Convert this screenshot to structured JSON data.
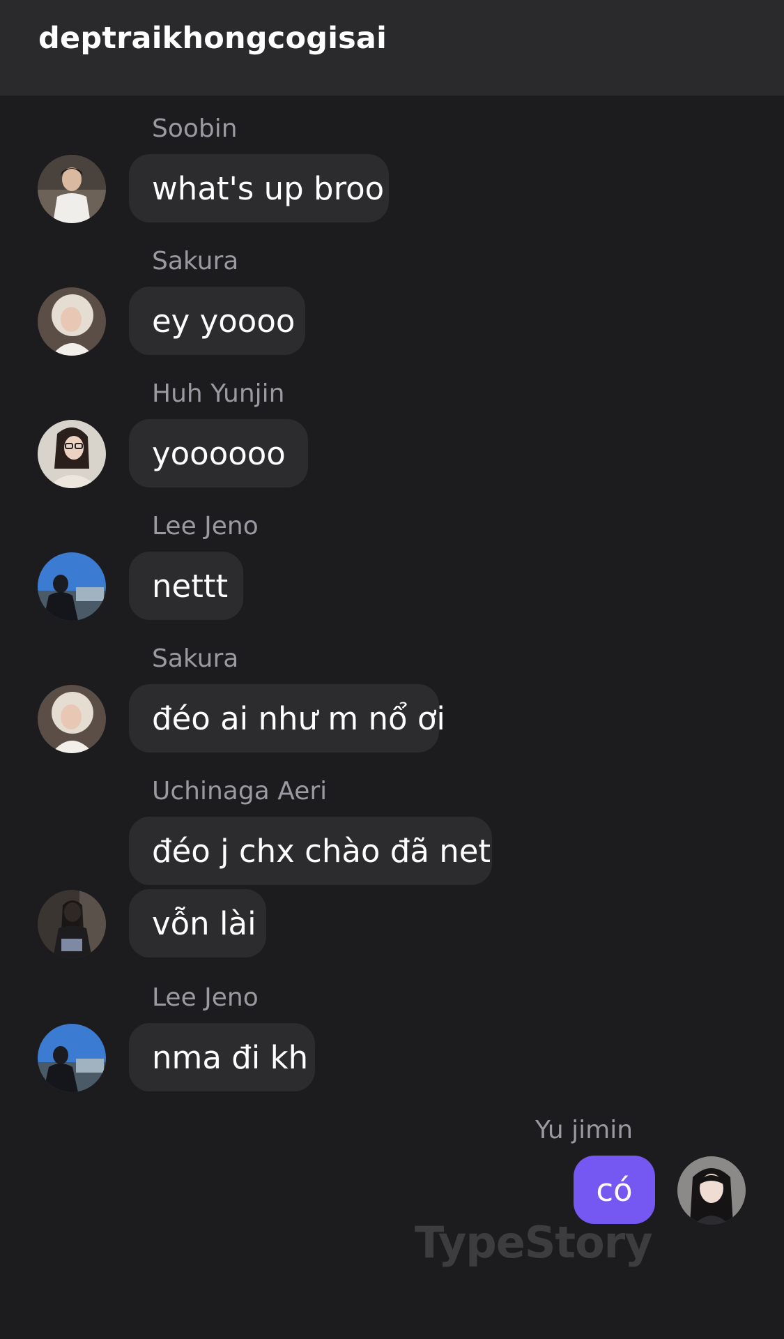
{
  "header": {
    "title": "deptraikhongcogisai"
  },
  "messages": [
    {
      "sender": "Soobin",
      "text": "what's up broo"
    },
    {
      "sender": "Sakura",
      "text": "ey yoooo"
    },
    {
      "sender": "Huh Yunjin",
      "text": "yoooooo"
    },
    {
      "sender": "Lee Jeno",
      "text": "nettt"
    },
    {
      "sender": "Sakura",
      "text": "đéo ai như m nổ ơi"
    },
    {
      "sender": "Uchinaga Aeri",
      "text": "đéo j chx chào đã net"
    },
    {
      "sender": "",
      "text": "vỗn lài"
    },
    {
      "sender": "Lee Jeno",
      "text": "nma đi kh"
    },
    {
      "sender": "Yu jimin",
      "text": "có"
    }
  ],
  "watermark": "TypeStory",
  "colors": {
    "background": "#1c1c1e",
    "header": "#2a2a2c",
    "bubble_other": "#2c2c2e",
    "bubble_self": "#7557f2",
    "sender_name": "#9a9aa0"
  },
  "avatars": {
    "soobin": "avatar-photo",
    "sakura": "avatar-photo",
    "huh_yunjin": "avatar-photo",
    "lee_jeno": "avatar-photo",
    "uchinaga_aeri": "avatar-photo",
    "yu_jimin": "avatar-photo"
  }
}
